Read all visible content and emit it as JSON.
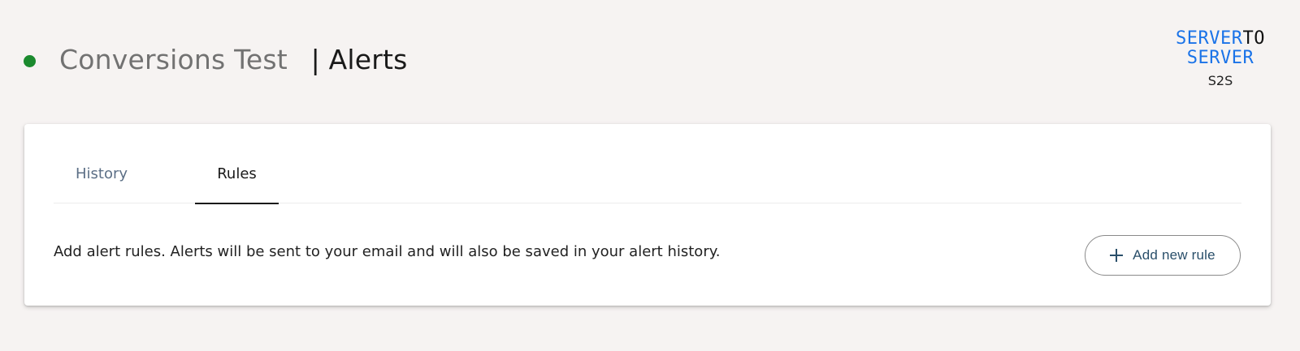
{
  "header": {
    "status_color": "#1b8a2e",
    "project_name": "Conversions Test",
    "separator": "|",
    "section": "Alerts"
  },
  "logo": {
    "line1_main": "SERVER",
    "line1_to": "TO",
    "line2": "SERVER",
    "sub": "S2S",
    "brand_color": "#1a73e8"
  },
  "tabs": [
    {
      "label": "History",
      "active": false
    },
    {
      "label": "Rules",
      "active": true
    }
  ],
  "rules": {
    "description": "Add alert rules. Alerts will be sent to your email and will also be saved in your alert history.",
    "add_button": {
      "icon": "plus-icon",
      "label": "Add new rule"
    }
  }
}
